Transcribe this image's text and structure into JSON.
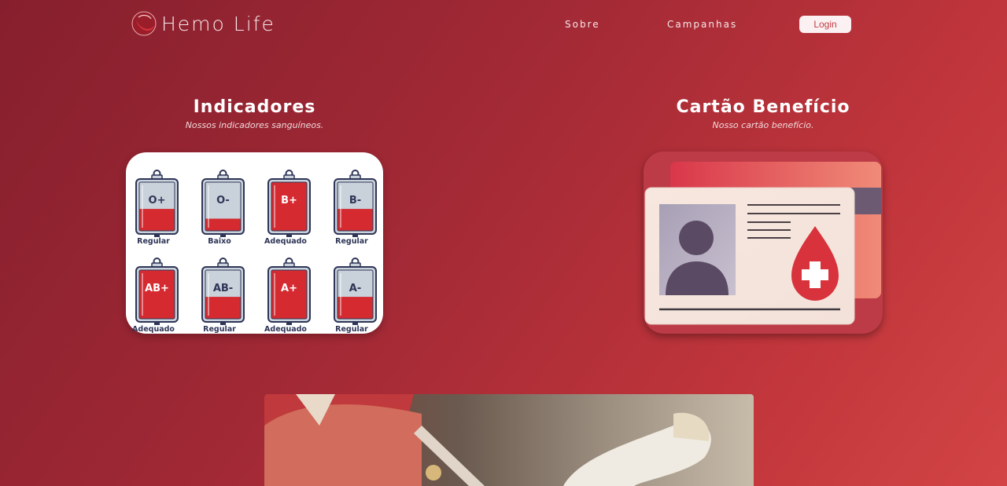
{
  "header": {
    "logo_text": "Hemo Life",
    "nav": [
      {
        "label": "Sobre"
      },
      {
        "label": "Campanhas"
      }
    ],
    "login_label": "Login"
  },
  "indicadores": {
    "title": "Indicadores",
    "subtitle": "Nossos indicadores sanguíneos.",
    "bags": [
      {
        "type": "O+",
        "status": "Regular",
        "level": 0.45
      },
      {
        "type": "O-",
        "status": "Baixo",
        "level": 0.25
      },
      {
        "type": "B+",
        "status": "Adequado",
        "level": 1.0
      },
      {
        "type": "B-",
        "status": "Regular",
        "level": 0.45
      },
      {
        "type": "AB+",
        "status": "Adequado",
        "level": 1.0
      },
      {
        "type": "AB-",
        "status": "Regular",
        "level": 0.45
      },
      {
        "type": "A+",
        "status": "Adequado",
        "level": 1.0
      },
      {
        "type": "A-",
        "status": "Regular",
        "level": 0.45
      }
    ]
  },
  "cartao": {
    "title": "Cartão Benefício",
    "subtitle": "Nosso cartão benefício."
  },
  "colors": {
    "blood": "#d42a30",
    "bag_outline": "#2e3557",
    "bag_empty": "#c9d1da",
    "status_text": "#2e3557"
  }
}
